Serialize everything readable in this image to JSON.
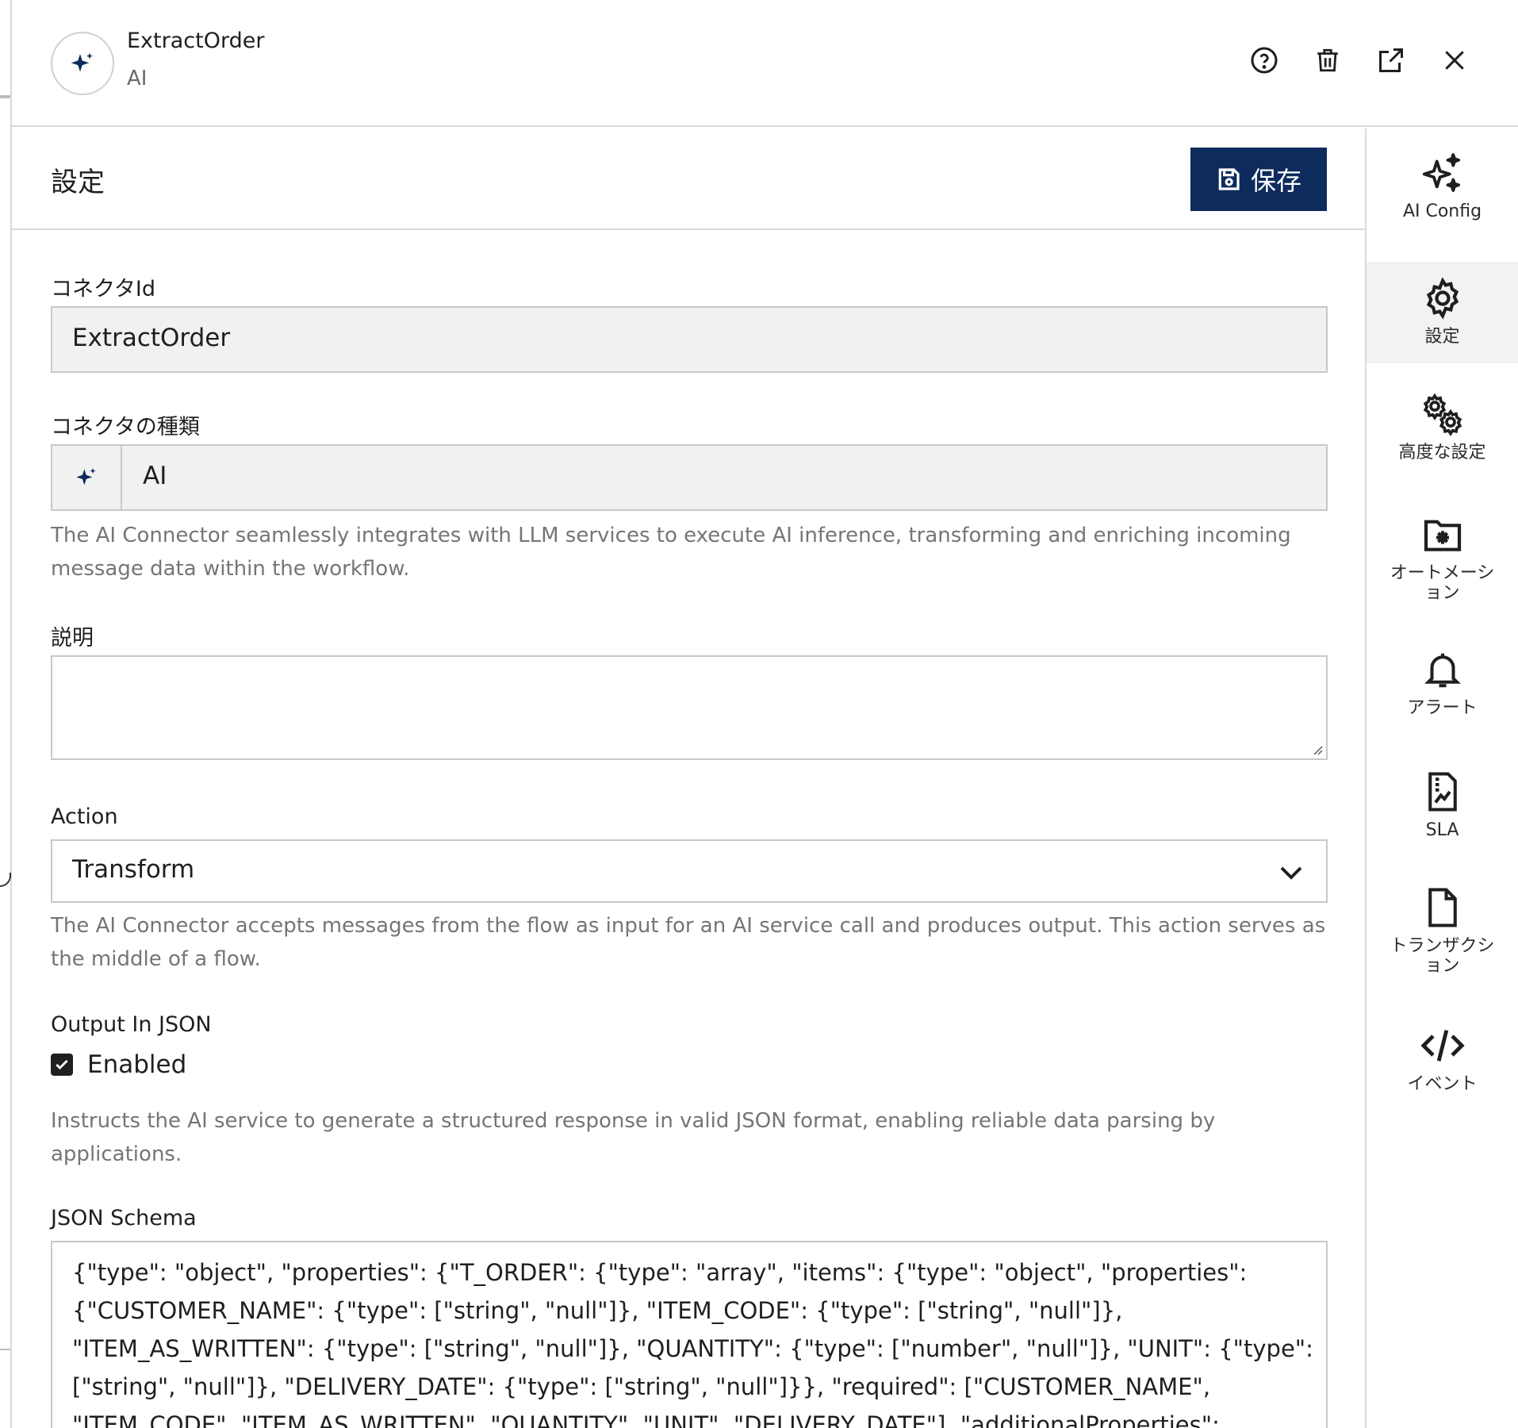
{
  "header": {
    "title": "ExtractOrder",
    "subtitle": "AI",
    "icons": {
      "avatar": "sparkle-icon",
      "help": "help-circle-icon",
      "delete": "trash-icon",
      "open": "external-link-icon",
      "close": "close-icon"
    }
  },
  "section": {
    "title": "設定",
    "save_label": "保存",
    "save_icon": "floppy-disk-icon"
  },
  "form": {
    "connector_id": {
      "label": "コネクタId",
      "value": "ExtractOrder"
    },
    "connector_type": {
      "label": "コネクタの種類",
      "value": "AI",
      "icon": "sparkle-icon",
      "help": "The AI Connector seamlessly integrates with LLM services to execute AI inference, transforming and enriching incoming message data within the workflow."
    },
    "description": {
      "label": "説明",
      "value": ""
    },
    "action": {
      "label": "Action",
      "value": "Transform",
      "help": "The AI Connector accepts messages from the flow as input for an AI service call and produces output. This action serves as the middle of a flow."
    },
    "output_json": {
      "label": "Output In JSON",
      "checkbox_label": "Enabled",
      "checked": true,
      "help": "Instructs the AI service to generate a structured response in valid JSON format, enabling reliable data parsing by applications."
    },
    "json_schema": {
      "label": "JSON Schema",
      "value": "{\"type\": \"object\", \"properties\": {\"T_ORDER\": {\"type\": \"array\", \"items\": {\"type\": \"object\", \"properties\": {\"CUSTOMER_NAME\": {\"type\": [\"string\", \"null\"]}, \"ITEM_CODE\": {\"type\": [\"string\", \"null\"]}, \"ITEM_AS_WRITTEN\": {\"type\": [\"string\", \"null\"]}, \"QUANTITY\": {\"type\": [\"number\", \"null\"]}, \"UNIT\": {\"type\": [\"string\", \"null\"]}, \"DELIVERY_DATE\": {\"type\": [\"string\", \"null\"]}}, \"required\": [\"CUSTOMER_NAME\", \"ITEM_CODE\", \"ITEM_AS_WRITTEN\", \"QUANTITY\", \"UNIT\", \"DELIVERY_DATE\"], \"additionalProperties\": false}}}, \"required\":"
    }
  },
  "rightnav": {
    "items": [
      {
        "label": "AI Config",
        "icon": "sparkles-icon"
      },
      {
        "label": "設定",
        "icon": "gear-icon",
        "active": true
      },
      {
        "label": "高度な設定",
        "icon": "gears-icon"
      },
      {
        "label": "オートメーション",
        "icon": "folder-gear-icon"
      },
      {
        "label": "アラート",
        "icon": "bell-icon"
      },
      {
        "label": "SLA",
        "icon": "document-chart-icon"
      },
      {
        "label": "トランザクション",
        "icon": "document-icon"
      },
      {
        "label": "イベント",
        "icon": "code-icon"
      }
    ]
  },
  "colors": {
    "primary": "#0d2b5c",
    "border": "#c8c8c8",
    "readonly_bg": "#f1f1f1",
    "muted_text": "#757575"
  }
}
